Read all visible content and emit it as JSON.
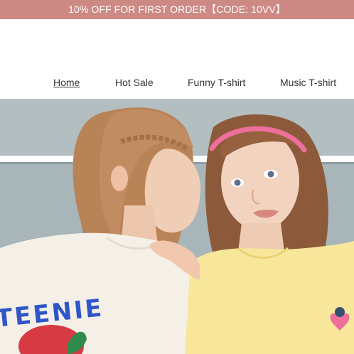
{
  "announcement": {
    "text": "10% OFF FOR FIRST ORDER【CODE: 10VV】",
    "background": "#cd8a84",
    "text_color": "#ffffff"
  },
  "nav": {
    "items": [
      {
        "label": "Home",
        "active": true
      },
      {
        "label": "Hot Sale",
        "active": false
      },
      {
        "label": "Funny T-shirt",
        "active": false
      },
      {
        "label": "Music T-shirt",
        "active": false
      }
    ]
  },
  "hero": {
    "shirt_print": "TEENIE",
    "colors": {
      "wall": "#a7b4b8",
      "stripe": "#ffffff",
      "cream_shirt": "#f3efe6",
      "yellow_shirt": "#f8e79b",
      "print_blue": "#2f56c8",
      "headband": "#ef6d9a"
    }
  }
}
